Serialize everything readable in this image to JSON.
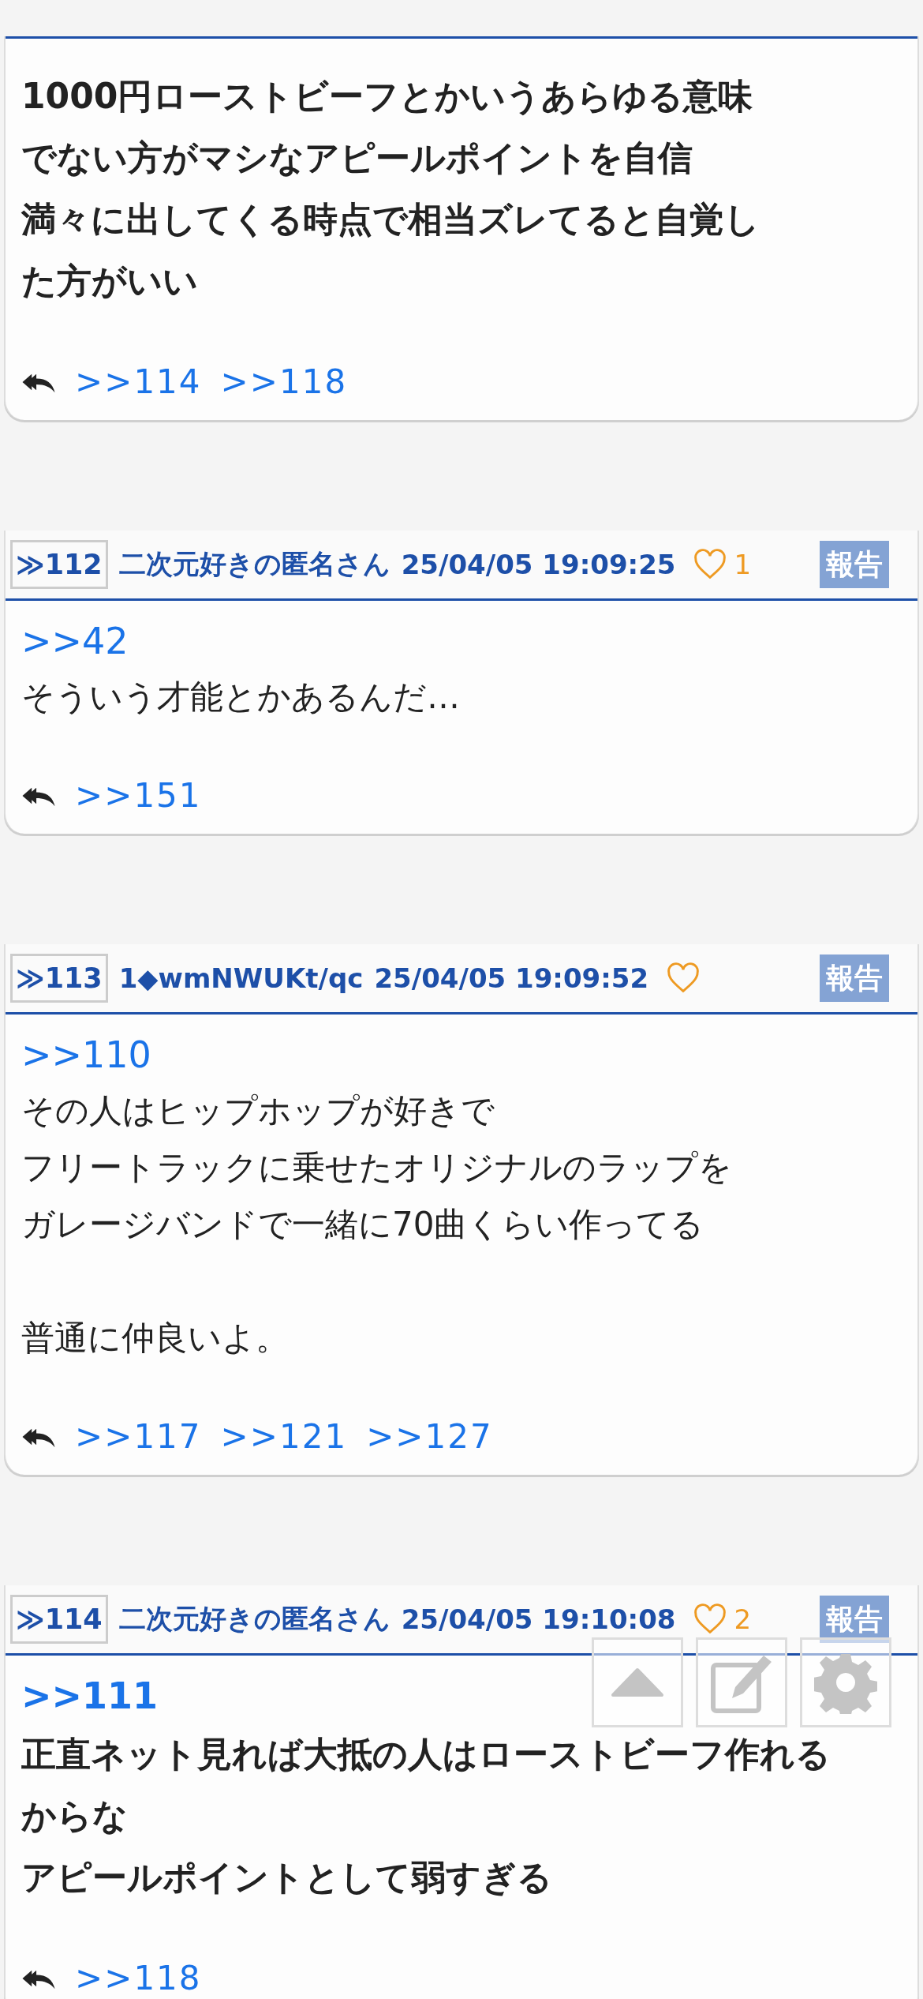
{
  "posts": [
    {
      "bold": true,
      "paragraphs": [
        [
          "1000円ローストビーフとかいうあらゆる意味",
          "でない方がマシなアピールポイントを自信",
          "満々に出してくる時点で相当ズレてると自覚し",
          "た方がいい"
        ]
      ],
      "replies": [
        ">>114",
        ">>118"
      ]
    },
    {
      "header": {
        "number": "≫112",
        "name": "二次元好きの匿名さん",
        "date": "25/04/05 19:09:25",
        "likes": "1",
        "report": "報告"
      },
      "anchor": ">>42",
      "bold": false,
      "paragraphs": [
        [
          "そういう才能とかあるんだ…"
        ]
      ],
      "replies": [
        ">>151"
      ]
    },
    {
      "header": {
        "number": "≫113",
        "name": "1◆wmNWUKt/qc",
        "date": "25/04/05 19:09:52",
        "report": "報告"
      },
      "anchor": ">>110",
      "bold": false,
      "paragraphs": [
        [
          "その人はヒップホップが好きで",
          "フリートラックに乗せたオリジナルのラップを",
          "ガレージバンドで一緒に70曲くらい作ってる"
        ],
        [
          "普通に仲良いよ。"
        ]
      ],
      "replies": [
        ">>117",
        ">>121",
        ">>127"
      ]
    },
    {
      "header": {
        "number": "≫114",
        "name": "二次元好きの匿名さん",
        "date": "25/04/05 19:10:08",
        "likes": "2",
        "report": "報告"
      },
      "anchor": ">>111",
      "bold": true,
      "paragraphs": [
        [
          "正直ネット見れば大抵の人はローストビーフ作れる",
          "からな",
          "アピールポイントとして弱すぎる"
        ]
      ],
      "replies": [
        ">>118"
      ]
    }
  ]
}
